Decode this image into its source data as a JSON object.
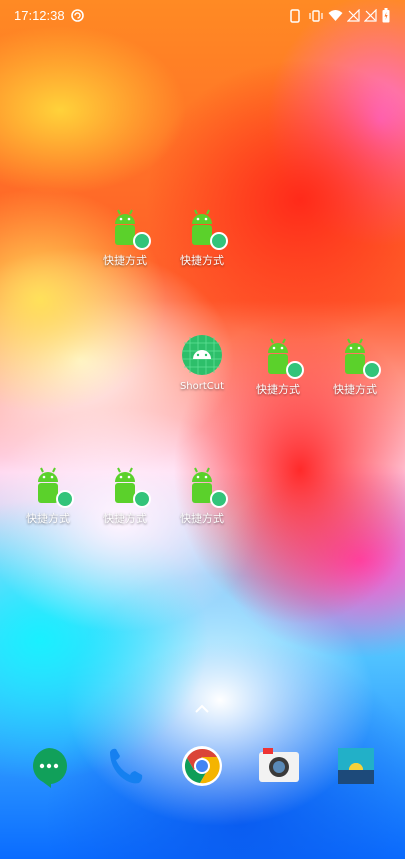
{
  "status_bar": {
    "time": "17:12:38",
    "icons": [
      "sync-icon",
      "phone-icon",
      "vibrate-icon",
      "wifi-icon",
      "no-sim-icon",
      "no-sim-icon",
      "battery-icon"
    ]
  },
  "home": {
    "shortcut_label": "快捷方式",
    "shortcut_app_label": "ShortCut",
    "accent_green": "#5bd12b",
    "badge_green": "#33c47a"
  },
  "dock": {
    "items": [
      "hangouts-icon",
      "phone-icon",
      "chrome-icon",
      "camera-icon",
      "gallery-icon"
    ]
  }
}
